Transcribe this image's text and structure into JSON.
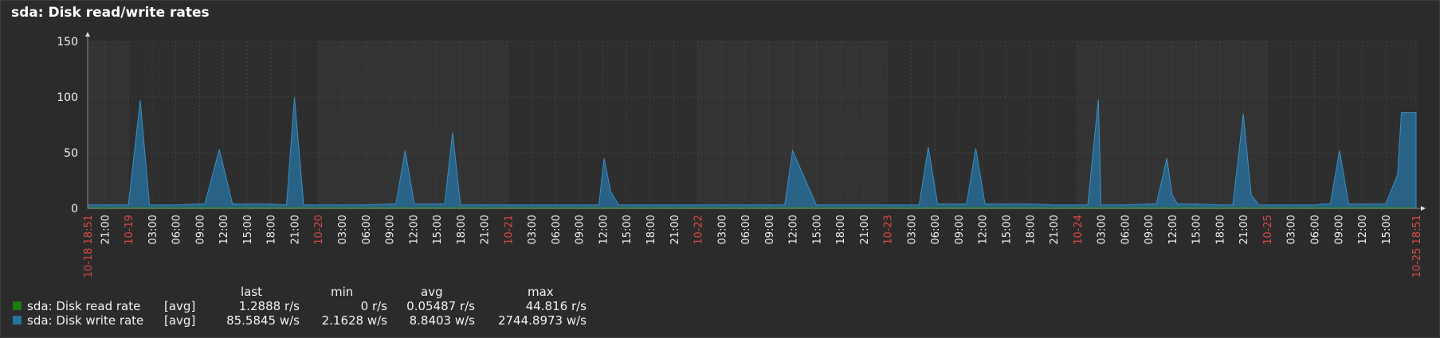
{
  "title": "sda: Disk read/write rates",
  "colors": {
    "read": "#1a7c11",
    "write": "#2774a4",
    "grid": "#444444",
    "axis_text": "#f2f2f2",
    "date_text": "#dc4a4a"
  },
  "legend": {
    "headers": {
      "last": "last",
      "min": "min",
      "avg": "avg",
      "max": "max"
    },
    "items": [
      {
        "name": "sda: Disk read rate",
        "fn": "[avg]",
        "last": "1.2888 r/s",
        "min": "0 r/s",
        "avg": "0.05487 r/s",
        "max": "44.816 r/s"
      },
      {
        "name": "sda: Disk write rate",
        "fn": "[avg]",
        "last": "85.5845 w/s",
        "min": "2.1628 w/s",
        "avg": "8.8403 w/s",
        "max": "2744.8973 w/s"
      }
    ]
  },
  "chart_data": {
    "type": "area",
    "title": "sda: Disk read/write rates",
    "ylim": [
      0,
      150
    ],
    "yticks": [
      "0",
      "50",
      "100",
      "150"
    ],
    "x_start": "10-18 18:51",
    "x_end": "10-25 18:51",
    "x_tick_labels": [
      "10-18 18:51",
      "21:00",
      "10-19",
      "03:00",
      "06:00",
      "09:00",
      "12:00",
      "15:00",
      "18:00",
      "21:00",
      "10-20",
      "03:00",
      "06:00",
      "09:00",
      "12:00",
      "15:00",
      "18:00",
      "21:00",
      "10-21",
      "03:00",
      "06:00",
      "09:00",
      "12:00",
      "15:00",
      "18:00",
      "21:00",
      "10-22",
      "03:00",
      "06:00",
      "09:00",
      "12:00",
      "15:00",
      "18:00",
      "21:00",
      "10-23",
      "03:00",
      "06:00",
      "09:00",
      "12:00",
      "15:00",
      "18:00",
      "21:00",
      "10-24",
      "03:00",
      "06:00",
      "09:00",
      "12:00",
      "15:00",
      "18:00",
      "21:00",
      "10-25",
      "03:00",
      "06:00",
      "09:00",
      "12:00",
      "15:00",
      "10-25 18:51"
    ],
    "grid": true,
    "series": [
      {
        "name": "sda: Disk read rate",
        "x": [
          "10-18 18:51",
          "10-25 18:51"
        ],
        "values": [
          0.3,
          0.3
        ]
      },
      {
        "name": "sda: Disk write rate",
        "x": [
          "10-18 18:51",
          "10-18 21:00",
          "10-19 00:00",
          "10-19 01:30",
          "10-19 02:40",
          "10-19 03:00",
          "10-19 06:00",
          "10-19 09:00",
          "10-19 09:40",
          "10-19 11:30",
          "10-19 13:10",
          "10-19 15:00",
          "10-19 18:00",
          "10-19 20:00",
          "10-19 21:00",
          "10-19 22:10",
          "10-19 23:00",
          "10-20 03:00",
          "10-20 06:00",
          "10-20 09:00",
          "10-20 09:50",
          "10-20 11:00",
          "10-20 12:10",
          "10-20 14:00",
          "10-20 16:00",
          "10-20 17:00",
          "10-20 18:00",
          "10-20 21:00",
          "10-21 03:00",
          "10-21 09:00",
          "10-21 11:30",
          "10-21 12:10",
          "10-21 13:00",
          "10-21 14:00",
          "10-21 15:00",
          "10-21 16:00",
          "10-21 18:00",
          "10-21 21:00",
          "10-22 03:00",
          "10-22 06:00",
          "10-22 09:00",
          "10-22 10:00",
          "10-22 11:00",
          "10-22 12:00",
          "10-22 15:00",
          "10-22 18:00",
          "10-23 00:00",
          "10-23 03:00",
          "10-23 04:00",
          "10-23 05:10",
          "10-23 06:20",
          "10-23 09:00",
          "10-23 10:00",
          "10-23 11:10",
          "10-23 12:20",
          "10-23 15:00",
          "10-23 18:00",
          "10-23 21:00",
          "10-24 00:00",
          "10-24 01:20",
          "10-24 02:40",
          "10-24 03:00",
          "10-24 06:00",
          "10-24 09:00",
          "10-24 10:00",
          "10-24 11:20",
          "10-24 12:00",
          "10-24 12:40",
          "10-24 13:30",
          "10-24 15:00",
          "10-24 18:00",
          "10-24 19:40",
          "10-24 21:00",
          "10-24 22:00",
          "10-24 23:00",
          "10-25 00:00",
          "10-25 03:00",
          "10-25 06:00",
          "10-25 07:00",
          "10-25 08:00",
          "10-25 09:10",
          "10-25 10:20",
          "10-25 12:00",
          "10-25 14:00",
          "10-25 15:00",
          "10-25 16:30",
          "10-25 17:00",
          "10-25 18:51"
        ],
        "values": [
          3,
          3,
          3,
          97,
          3,
          3,
          3,
          4,
          4,
          53,
          4,
          4,
          4,
          3,
          100,
          3,
          3,
          3,
          3,
          4,
          4,
          52,
          4,
          4,
          4,
          68,
          3,
          3,
          3,
          3,
          3,
          45,
          15,
          3,
          3,
          3,
          3,
          3,
          3,
          3,
          3,
          3,
          3,
          52,
          3,
          3,
          3,
          3,
          3,
          55,
          4,
          4,
          4,
          54,
          4,
          4,
          4,
          3,
          3,
          3,
          98,
          3,
          3,
          4,
          4,
          45,
          12,
          4,
          4,
          4,
          3,
          3,
          85,
          12,
          3,
          3,
          3,
          3,
          4,
          4,
          52,
          4,
          4,
          4,
          4,
          30,
          86,
          86
        ]
      }
    ]
  }
}
